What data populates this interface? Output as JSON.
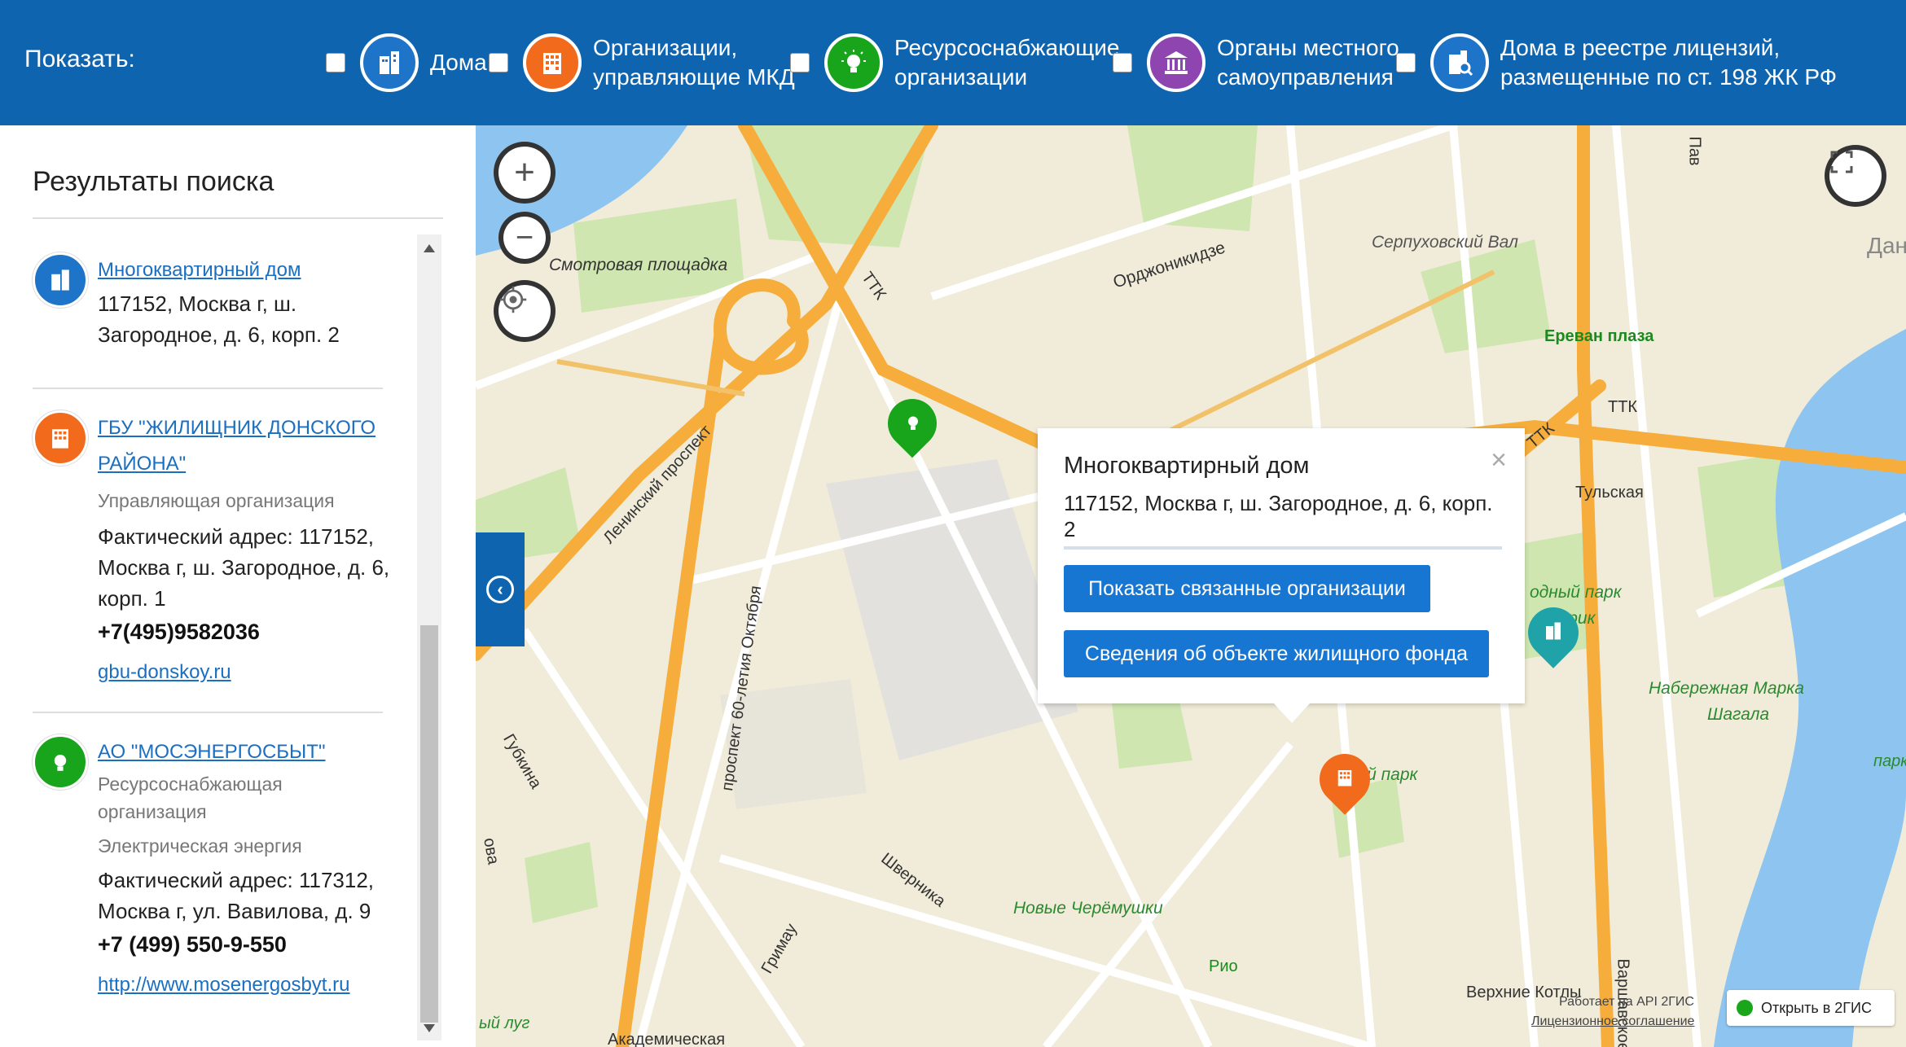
{
  "header": {
    "show_label": "Показать:",
    "filters": [
      {
        "label": "Дома",
        "icon": "building-icon",
        "color": "#1e74c8"
      },
      {
        "label": "Организации,\nуправляющие МКД",
        "icon": "office-building-icon",
        "color": "#f26b1d"
      },
      {
        "label": "Ресурсоснабжающие\nорганизации",
        "icon": "lightbulb-icon",
        "color": "#18a51b"
      },
      {
        "label": "Органы местного\nсамоуправления",
        "icon": "government-building-icon",
        "color": "#8e45b0"
      },
      {
        "label": "Дома в реестре лицензий,\nразмещенные по ст. 198 ЖК РФ",
        "icon": "building-search-icon",
        "color": "#1e74c8"
      }
    ]
  },
  "sidebar": {
    "title": "Результаты поиска",
    "results": [
      {
        "icon": "building-icon",
        "color": "#1e74c8",
        "name": "Многоквартирный дом",
        "address": "117152, Москва г, ш. Загородное, д. 6, корп. 2"
      },
      {
        "icon": "office-building-icon",
        "color": "#f26b1d",
        "name": "ГБУ \"ЖИЛИЩНИК ДОНСКОГО РАЙОНА\"",
        "type": "Управляющая организация",
        "address": "Фактический адрес: 117152, Москва г, ш. Загородное, д. 6, корп. 1",
        "phone": "+7(495)9582036",
        "site": "gbu-donskoy.ru"
      },
      {
        "icon": "lightbulb-icon",
        "color": "#18a51b",
        "name": "АО \"МОСЭНЕРГОСБЫТ\"",
        "type": "Ресурсоснабжающая организация",
        "resource": "Электрическая энергия",
        "address": "Фактический адрес: 117312, Москва г, ул. Вавилова, д. 9",
        "phone": "+7 (499) 550-9-550",
        "site": "http://www.mosenergosbyt.ru"
      }
    ]
  },
  "map": {
    "controls": {
      "zoom_in": "+",
      "zoom_out": "−"
    },
    "labels": [
      "Смотровая площадка",
      "ТТК",
      "Орджоникидзе",
      "Серпуховский Вал",
      "Ереван плаза",
      "Ленинский проспект",
      "проспект 60-летия Октября",
      "ТТК",
      "ТТК",
      "Тульская",
      "одный парк",
      "зорик",
      "Набережная Марка",
      "Шагала",
      "ский парк",
      "Губкина",
      "Шверника",
      "Новые Черёмушки",
      "Гримау",
      "Рио",
      "Верхние Котлы",
      "Варшавское ш",
      "Академическая",
      "ый луг",
      "Дан",
      "парк",
      "ова",
      "Пав"
    ],
    "popup": {
      "title": "Многоквартирный дом",
      "address": "117152, Москва г, ш. Загородное, д. 6, корп. 2",
      "btn_related": "Показать связанные организации",
      "btn_info": "Сведения об объекте жилищного фонда",
      "close": "×"
    },
    "attribution": {
      "api": "Работает на API 2ГИС",
      "license": "Лицензионное соглашение",
      "open": "Открыть в 2ГИС"
    }
  }
}
